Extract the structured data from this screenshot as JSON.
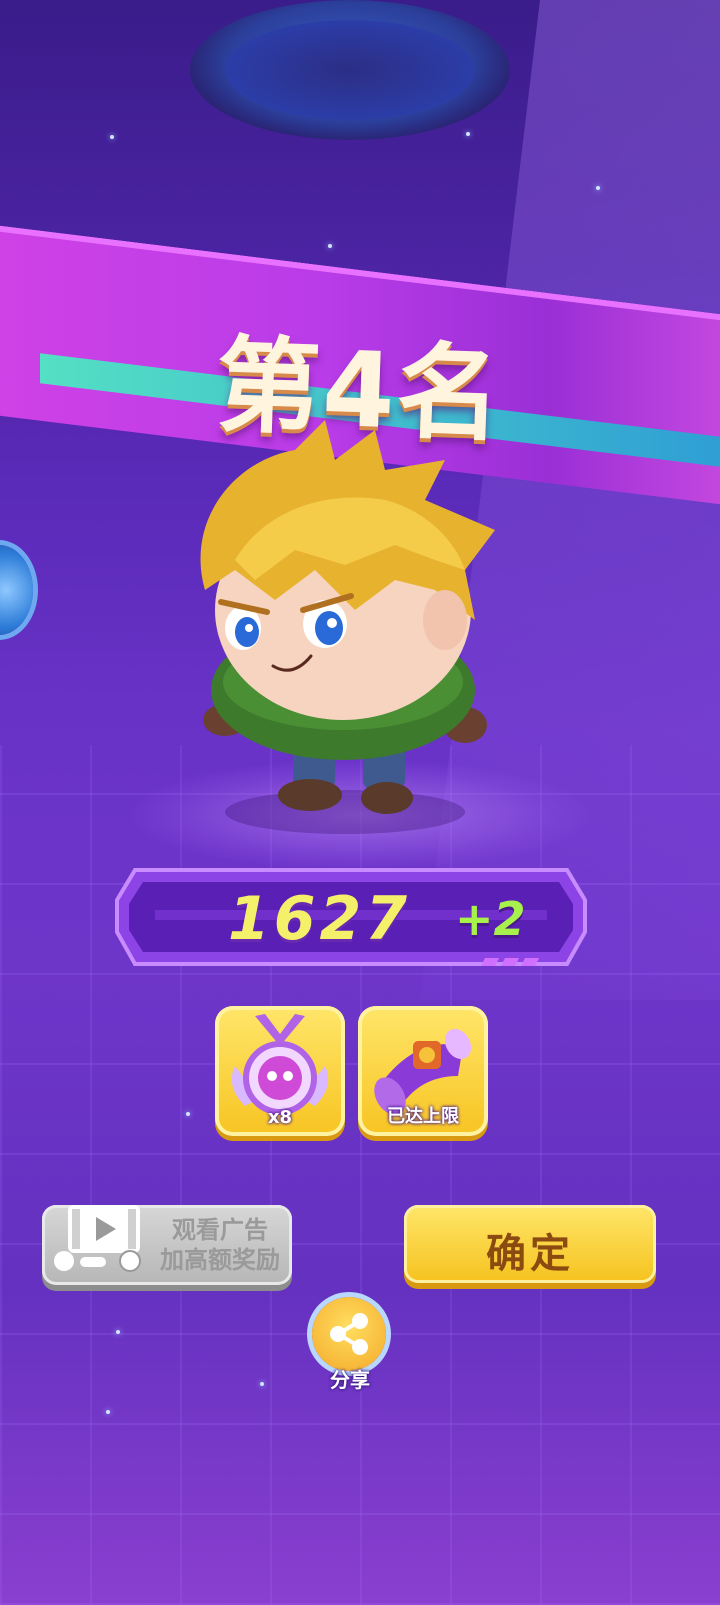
{
  "result": {
    "rank_label": "第4名",
    "score": "1627",
    "score_change": "+2"
  },
  "rewards": [
    {
      "icon": "skull-medal-icon",
      "label": "x8"
    },
    {
      "icon": "purple-scroll-icon",
      "label": "已达上限"
    }
  ],
  "buttons": {
    "watch_ad_label": "观看广告\n加高额奖励",
    "watch_ad_line1": "观看广告",
    "watch_ad_line2": "加高额奖励",
    "confirm_label": "确定",
    "share_label": "分享"
  },
  "colors": {
    "banner": "#c03ce6",
    "score_value": "#f5f06a",
    "score_delta": "#a8f04c",
    "confirm_button": "#f7c422",
    "ad_button_disabled": "#c4c4c4"
  }
}
